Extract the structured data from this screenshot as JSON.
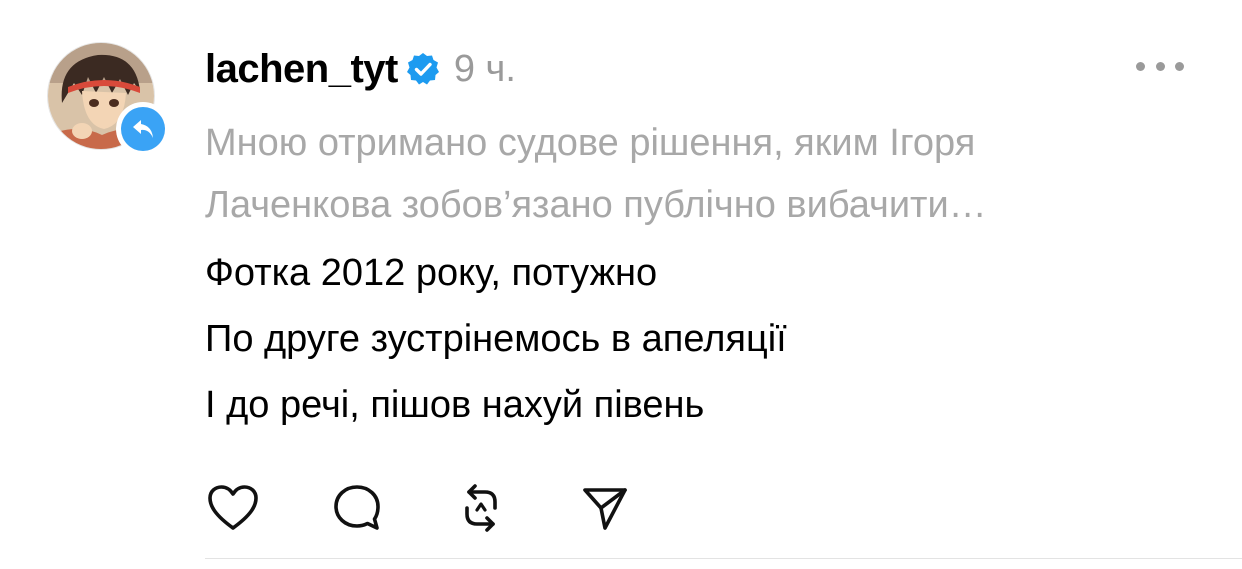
{
  "post": {
    "author": {
      "username": "lachen_tyt",
      "verified": true,
      "avatar_icon": "anime-avatar",
      "badge_icon": "repost-icon"
    },
    "time": "9 ч.",
    "more_icon": "more-dots-icon",
    "quoted_lines": [
      "Мною отримано судове рішення, яким Ігоря",
      "Лаченкова зобов’язано публічно вибачити…"
    ],
    "body_lines": [
      "Фотка 2012 року, потужно",
      "По друге зустрінемось в апеляції",
      "І до речі, пішов нахуй півень"
    ],
    "actions": [
      {
        "icon": "heart-icon"
      },
      {
        "icon": "comment-icon"
      },
      {
        "icon": "repost-icon"
      },
      {
        "icon": "share-icon"
      }
    ]
  },
  "colors": {
    "accent": "#3aa3f5",
    "muted_text": "#a8a8a8",
    "divider": "#e3e3e3"
  }
}
